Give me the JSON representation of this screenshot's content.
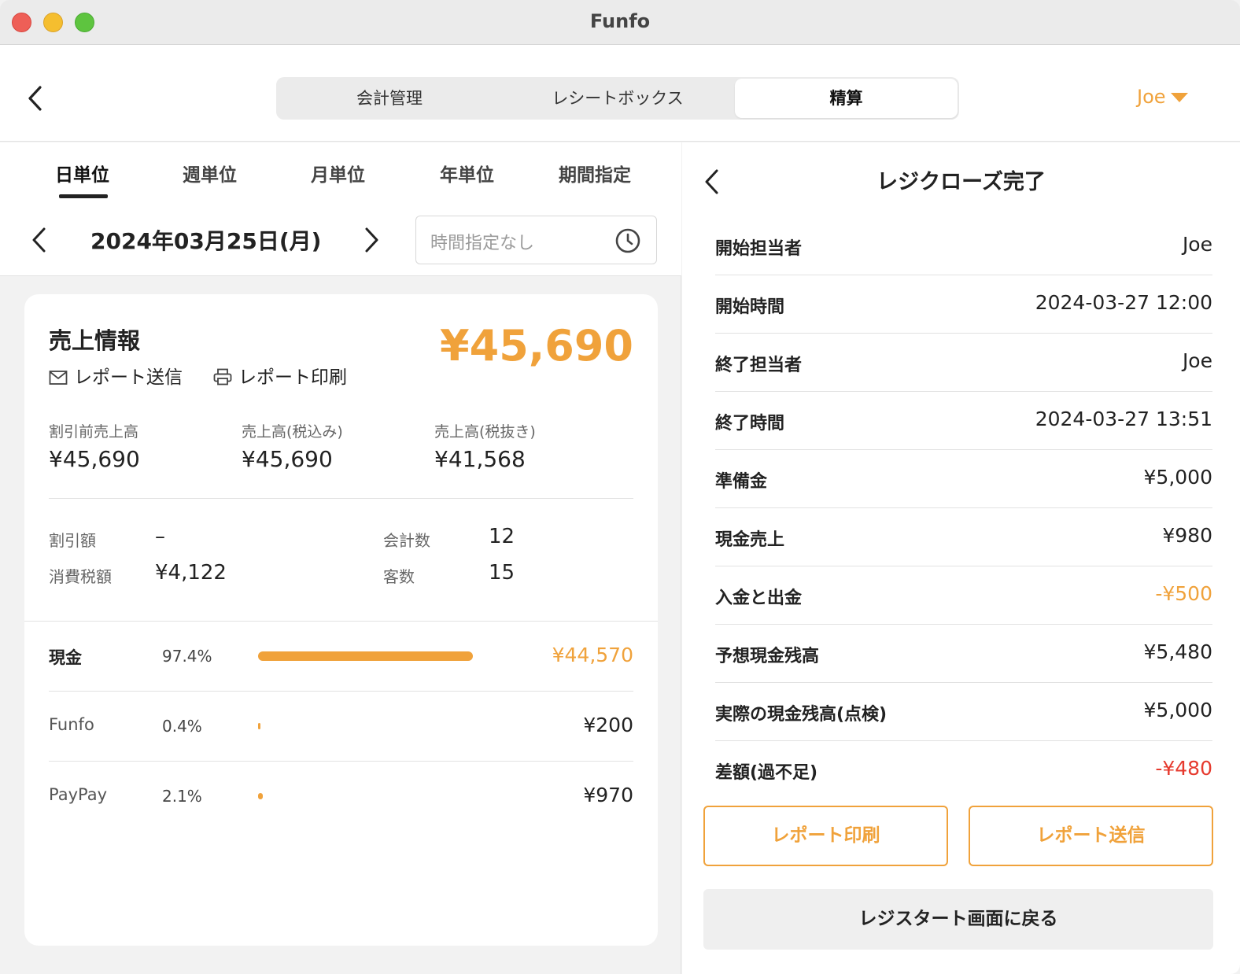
{
  "window": {
    "title": "Funfo"
  },
  "header": {
    "tabs": [
      "会計管理",
      "レシートボックス",
      "精算"
    ],
    "active_tab": "精算",
    "user": "Joe"
  },
  "period": {
    "tabs": [
      "日単位",
      "週単位",
      "月単位",
      "年単位",
      "期間指定"
    ],
    "active": "日単位",
    "date": "2024年03月25日(月)",
    "time_placeholder": "時間指定なし"
  },
  "sales": {
    "title": "売上情報",
    "total": "¥45,690",
    "send_report": "レポート送信",
    "print_report": "レポート印刷",
    "stats": [
      {
        "label": "割引前売上高",
        "value": "¥45,690"
      },
      {
        "label": "売上高(税込み)",
        "value": "¥45,690"
      },
      {
        "label": "売上高(税抜き)",
        "value": "¥41,568"
      }
    ],
    "details": {
      "discount_label": "割引額",
      "discount_value": "–",
      "tax_label": "消費税額",
      "tax_value": "¥4,122",
      "checks_label": "会計数",
      "checks_value": "12",
      "customers_label": "客数",
      "customers_value": "15"
    },
    "payments": [
      {
        "name": "現金",
        "percent_label": "97.4%",
        "percent": 97.4,
        "amount": "¥44,570"
      },
      {
        "name": "Funfo",
        "percent_label": "0.4%",
        "percent": 0.4,
        "amount": "¥200"
      },
      {
        "name": "PayPay",
        "percent_label": "2.1%",
        "percent": 2.1,
        "amount": "¥970"
      }
    ]
  },
  "close": {
    "title": "レジクローズ完了",
    "rows": [
      {
        "label": "開始担当者",
        "value": "Joe"
      },
      {
        "label": "開始時間",
        "value": "2024-03-27 12:00"
      },
      {
        "label": "終了担当者",
        "value": "Joe"
      },
      {
        "label": "終了時間",
        "value": "2024-03-27 13:51"
      },
      {
        "label": "準備金",
        "value": "¥5,000"
      },
      {
        "label": "現金売上",
        "value": "¥980"
      },
      {
        "label": "入金と出金",
        "value": "-¥500"
      },
      {
        "label": "予想現金残高",
        "value": "¥5,480"
      },
      {
        "label": "実際の現金残高(点検)",
        "value": "¥5,000"
      },
      {
        "label": "差額(過不足)",
        "value": "-¥480"
      }
    ],
    "print_button": "レポート印刷",
    "send_button": "レポート送信",
    "back_button": "レジスタート画面に戻る"
  },
  "colors": {
    "accent": "#f0a23b",
    "negative": "#e63a2e"
  }
}
